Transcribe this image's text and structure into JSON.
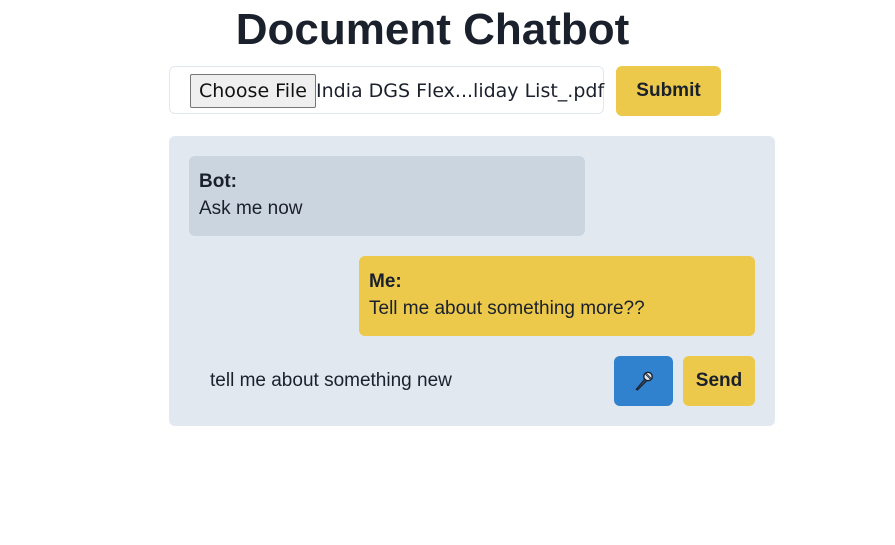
{
  "app": {
    "title": "Document Chatbot"
  },
  "upload": {
    "choose_file_label": "Choose File",
    "file_name": "India DGS Flex...liday List_.pdf",
    "submit_label": "Submit"
  },
  "chat": {
    "messages": [
      {
        "sender": "Bot:",
        "text": "Ask me now"
      },
      {
        "sender": "Me:",
        "text": "Tell me about something more??"
      }
    ],
    "input_value": "tell me about something new",
    "mic_icon": "microphone-icon",
    "send_label": "Send"
  },
  "colors": {
    "accent_yellow": "#ecc94b",
    "mic_blue": "#3182ce",
    "panel_bg": "#e2e8f0",
    "bot_bubble": "#cbd5e0",
    "text": "#1a202c"
  }
}
